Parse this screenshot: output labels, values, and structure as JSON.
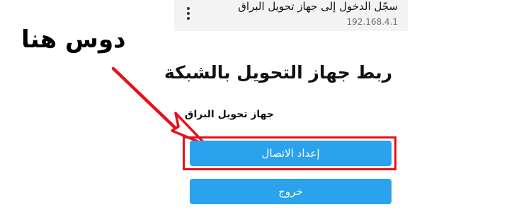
{
  "browser": {
    "title": "سجّل الدخول إلى جهاز تحويل البراق",
    "url": "192.168.4.1",
    "menu_icon": "kebab-menu-icon"
  },
  "annotation": {
    "text": "دوس هنا",
    "color": "#e8101a"
  },
  "page": {
    "heading": "ربط جهاز التحويل بالشبكة",
    "device_label": "جهاز تحويل البراق",
    "buttons": {
      "setup": "إعداد الاتصال",
      "exit": "خروج"
    },
    "button_color": "#2aa2ec"
  }
}
